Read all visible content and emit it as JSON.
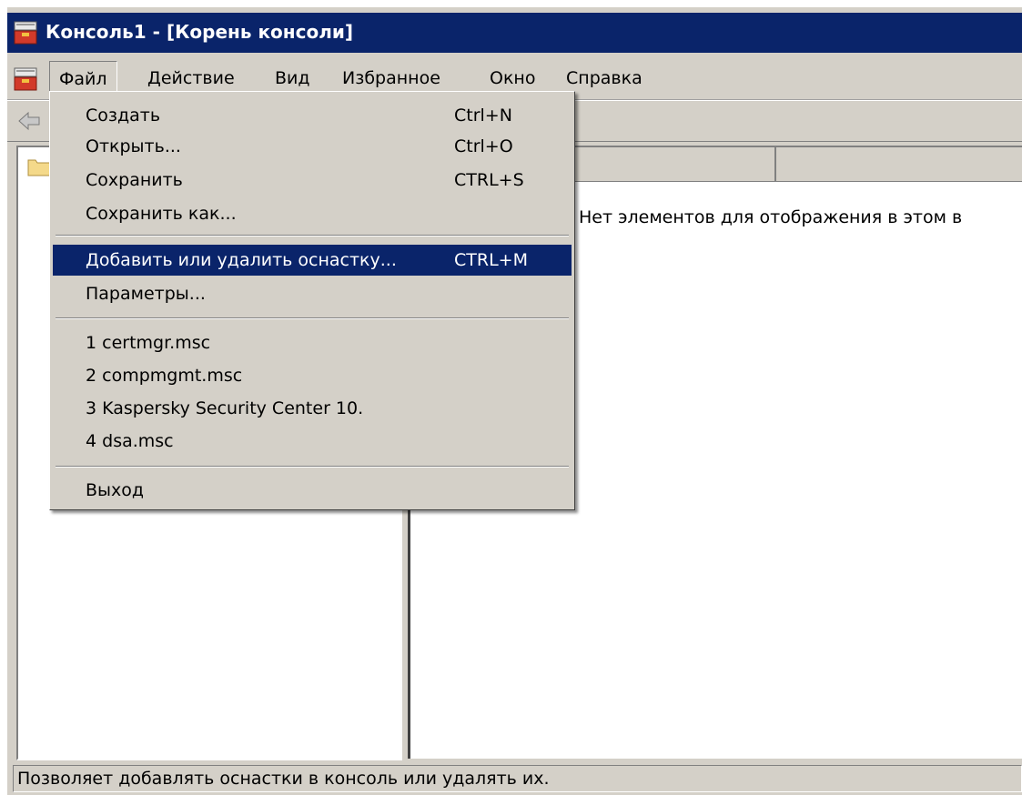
{
  "window": {
    "title": "Консоль1 - [Корень консоли]"
  },
  "menubar": {
    "items": [
      "Файл",
      "Действие",
      "Вид",
      "Избранное",
      "Окно",
      "Справка"
    ]
  },
  "file_menu": {
    "items": [
      {
        "label": "Создать",
        "shortcut": "Ctrl+N"
      },
      {
        "label": "Открыть...",
        "shortcut": "Ctrl+O"
      },
      {
        "label": "Сохранить",
        "shortcut": "CTRL+S"
      },
      {
        "label": "Сохранить как...",
        "shortcut": ""
      },
      {
        "label": "Добавить или удалить оснастку...",
        "shortcut": "CTRL+M"
      },
      {
        "label": "Параметры...",
        "shortcut": ""
      },
      {
        "label": "1 certmgr.msc",
        "shortcut": ""
      },
      {
        "label": "2 compmgmt.msc",
        "shortcut": ""
      },
      {
        "label": "3 Kaspersky Security Center 10.",
        "shortcut": ""
      },
      {
        "label": "4 dsa.msc",
        "shortcut": ""
      },
      {
        "label": "Выход",
        "shortcut": ""
      }
    ]
  },
  "result_pane": {
    "empty_message": "Нет элементов для отображения в этом в"
  },
  "statusbar": {
    "text": "Позволяет добавлять оснастки в консоль или удалять их."
  },
  "colors": {
    "titlebar": "#0a246a",
    "highlight": "#0a246a",
    "face": "#d4d0c8"
  },
  "icons": {
    "app": "mmc-toolbox-icon",
    "back": "back-arrow-icon",
    "folder": "folder-icon"
  }
}
